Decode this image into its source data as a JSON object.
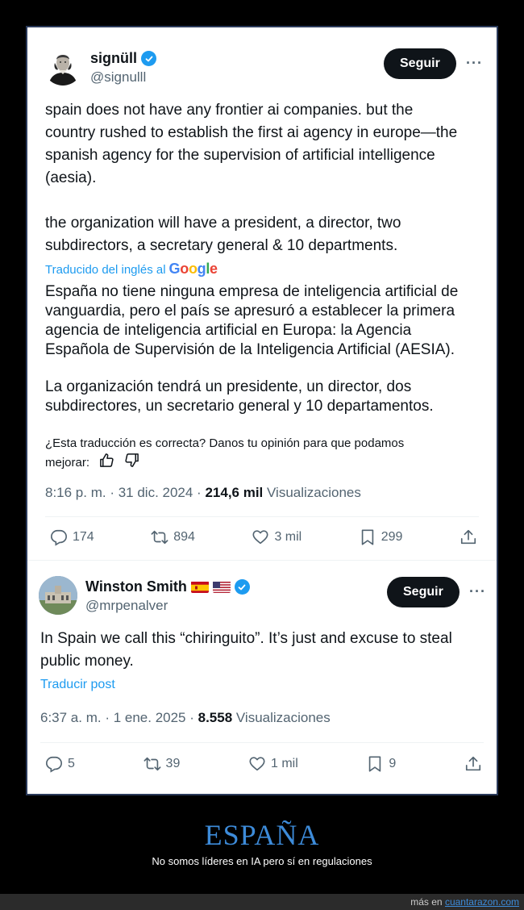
{
  "tweet1": {
    "author_name": "signüll",
    "handle": "@signulll",
    "follow_label": "Seguir",
    "more_label": "···",
    "text_p1": "spain does not have any frontier ai companies. but the\ncountry rushed to establish the first ai agency in europe—the\nspanish agency for the supervision of artificial intelligence\n(aesia).",
    "text_p2": "the organization will have a president, a director, two\nsubdirectors, a secretary general & 10 departments.",
    "translated_by": "Traducido del inglés al",
    "google_letters": [
      "G",
      "o",
      "o",
      "g",
      "l",
      "e"
    ],
    "translation_p1": "España no tiene ninguna empresa de inteligencia artificial de\nvanguardia, pero el país se apresuró a establecer la primera\nagencia de inteligencia artificial en Europa: la Agencia\nEspañola de Supervisión de la Inteligencia Artificial (AESIA).",
    "translation_p2": "La organización tendrá un presidente, un director, dos\nsubdirectores, un secretario general y 10 departamentos.",
    "feedback_line1": "¿Esta traducción es correcta? Danos tu opinión para que podamos",
    "feedback_line2": "mejorar:",
    "time": "8:16 p. m. · 31 dic. 2024 · ",
    "views_count": "214,6 mil",
    "views_label": " Visualizaciones",
    "replies": "174",
    "retweets": "894",
    "likes": "3 mil",
    "bookmarks": "299"
  },
  "tweet2": {
    "author_name": "Winston Smith",
    "handle": "@mrpenalver",
    "follow_label": "Seguir",
    "more_label": "···",
    "text": "In Spain we call this “chiringuito”. It’s just and excuse to steal\npublic money.",
    "translate_link": "Traducir post",
    "time": "6:37 a. m. · 1 ene. 2025 · ",
    "views_count": "8.558",
    "views_label": " Visualizaciones",
    "replies": "5",
    "retweets": "39",
    "likes": "1 mil",
    "bookmarks": "9"
  },
  "caption": {
    "title": "ESPAÑA",
    "subtitle": "No somos líderes en IA pero sí en regulaciones"
  },
  "footer": {
    "prefix": "más en ",
    "site": "cuantarazon.com"
  },
  "colors": {
    "accent": "#1d9bf0",
    "caption_title": "#3d8bd9",
    "follow_bg": "#0f1419"
  }
}
